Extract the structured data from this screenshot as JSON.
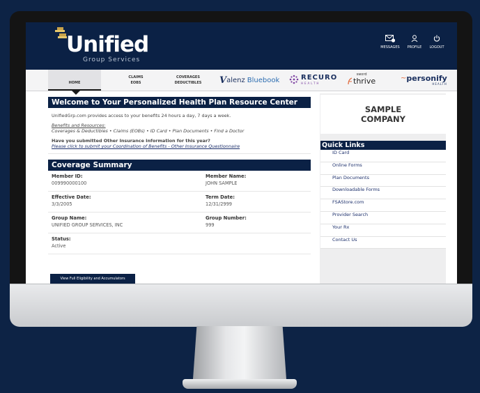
{
  "colors": {
    "navy": "#0b2145",
    "background": "#0d2345",
    "gold": "#c8a24a"
  },
  "logo": {
    "name": "Unified",
    "sub": "Group Services"
  },
  "header_actions": [
    {
      "label": "MESSAGES",
      "icon": "mail-icon"
    },
    {
      "label": "PROFILE",
      "icon": "person-icon"
    },
    {
      "label": "LOGOUT",
      "icon": "power-icon"
    }
  ],
  "nav": {
    "home": "HOME",
    "claims": [
      "CLAIMS",
      "EOBS"
    ],
    "coverages": [
      "COVERAGES",
      "DEDUCTIBLES"
    ],
    "partners": {
      "valenz_mark": "V",
      "valenz": "alenz",
      "bluebook": "Bluebook",
      "recuro": "RECURO",
      "recuro_sub": "HEALTH",
      "sword": "sword",
      "thrive": "thrive",
      "personify": "personify",
      "personify_sub": "HEALTH"
    }
  },
  "welcome": {
    "title": "Welcome to Your Personalized Health Plan Resource Center",
    "intro": "UnifiedGrp.com provides access to your benefits 24 hours a day, 7 days a week.",
    "benefits_heading": "Benefits and Resources:",
    "benefits_list": "Coverages & Deductibles • Claims (EOBs) • ID Card • Plan Documents • Find a Doctor",
    "question": "Have you submitted Other Insurance Information for this year?",
    "link": "Please click to submit your Coordination of Benefits - Other Insurance Questionnaire"
  },
  "coverage": {
    "title": "Coverage Summary",
    "member_id_label": "Member ID:",
    "member_id": "009990000100",
    "member_name_label": "Member Name:",
    "member_name": "JOHN SAMPLE",
    "effective_label": "Effective Date:",
    "effective": "3/3/2005",
    "term_label": "Term Date:",
    "term": "12/31/2999",
    "group_name_label": "Group Name:",
    "group_name": "UNIFIED GROUP SERVICES, INC",
    "group_number_label": "Group Number:",
    "group_number": "999",
    "status_label": "Status:",
    "status": "Active",
    "button": "View Full Eligibility and Accumulators"
  },
  "sidebar": {
    "company_line1": "SAMPLE",
    "company_line2": "COMPANY",
    "quick_links_title": "Quick Links",
    "links": [
      "ID Card",
      "Online Forms",
      "Plan Documents",
      "Downloadable Forms",
      "FSAStore.com",
      "Provider Search",
      "Your Rx",
      "Contact Us"
    ]
  }
}
